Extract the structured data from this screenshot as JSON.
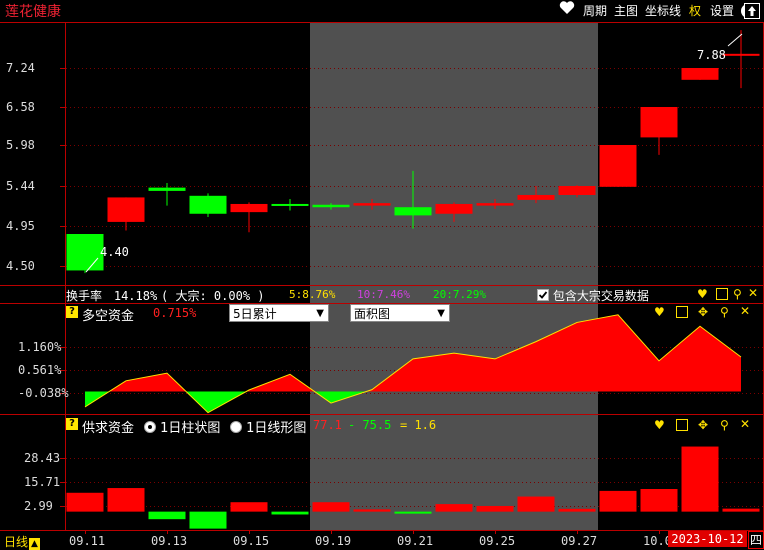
{
  "topbar": {
    "stock_name": "莲花健康",
    "menu": [
      "周期",
      "主图",
      "坐标线",
      "权",
      "设置"
    ],
    "heart_icon": "heart-icon",
    "restore_icon": "restore-icon",
    "up_icon": "up-arrow-icon"
  },
  "main": {
    "yticks": [
      "7.24",
      "6.58",
      "5.98",
      "5.44",
      "4.95",
      "4.50"
    ],
    "low_label": "4.40",
    "high_label": "7.88",
    "candles": [
      {
        "o": 4.86,
        "c": 4.45,
        "h": 4.86,
        "l": 4.42
      },
      {
        "o": 5.0,
        "c": 5.3,
        "h": 5.3,
        "l": 4.9
      },
      {
        "o": 5.42,
        "c": 5.38,
        "h": 5.48,
        "l": 5.2
      },
      {
        "o": 5.32,
        "c": 5.1,
        "h": 5.35,
        "l": 5.06
      },
      {
        "o": 5.12,
        "c": 5.22,
        "h": 5.24,
        "l": 4.88
      },
      {
        "o": 5.22,
        "c": 5.2,
        "h": 5.28,
        "l": 5.14
      },
      {
        "o": 5.21,
        "c": 5.18,
        "h": 5.23,
        "l": 5.15
      },
      {
        "o": 5.2,
        "c": 5.23,
        "h": 5.28,
        "l": 5.15
      },
      {
        "o": 5.18,
        "c": 5.08,
        "h": 5.64,
        "l": 4.92
      },
      {
        "o": 5.1,
        "c": 5.22,
        "h": 5.24,
        "l": 5.0
      },
      {
        "o": 5.2,
        "c": 5.23,
        "h": 5.28,
        "l": 5.16
      },
      {
        "o": 5.27,
        "c": 5.33,
        "h": 5.44,
        "l": 5.23
      },
      {
        "o": 5.33,
        "c": 5.44,
        "h": 5.45,
        "l": 5.3
      },
      {
        "o": 5.43,
        "c": 5.98,
        "h": 5.98,
        "l": 5.43
      },
      {
        "o": 6.1,
        "c": 6.58,
        "h": 6.58,
        "l": 5.85
      },
      {
        "o": 7.04,
        "c": 7.24,
        "h": 7.24,
        "l": 7.04
      },
      {
        "o": 7.48,
        "c": 7.48,
        "h": 7.88,
        "l": 6.9
      }
    ],
    "colors": {
      "up": "#ff0000",
      "down": "#00ff00",
      "flat": "#ff0000"
    }
  },
  "turnover": {
    "label": "换手率",
    "value": "14.18%",
    "block": "( 大宗: 0.00% )",
    "ma5": "5:8.76%",
    "ma10": "10:7.46%",
    "ma20": "20:7.29%",
    "checkbox_label": "包含大宗交易数据"
  },
  "panel2": {
    "title": "多空资金",
    "value": "0.715%",
    "dropdown1": "5日累计",
    "dropdown2": "面积图",
    "yticks": [
      "1.160%",
      "0.561%",
      "-0.038%"
    ],
    "series": [
      -0.4,
      0.28,
      0.48,
      -0.55,
      0.04,
      0.45,
      -0.3,
      0.05,
      0.85,
      1.0,
      0.85,
      1.3,
      1.8,
      2.0,
      0.8,
      1.7,
      0.9
    ]
  },
  "panel3": {
    "title": "供求资金",
    "radio1": "1日柱状图",
    "radio2": "1日线形图",
    "val_a": "77.1",
    "val_b": "- 75.5",
    "val_c": "= 1.6",
    "yticks": [
      "28.43",
      "15.71",
      "2.99"
    ],
    "bars": [
      10.0,
      12.5,
      -4.0,
      -9.0,
      5.0,
      -1.5,
      5.0,
      1.2,
      -0.4,
      4.0,
      3.0,
      8.0,
      1.5,
      11.0,
      12.0,
      34.5,
      1.6
    ]
  },
  "xaxis": {
    "period_label": "日线",
    "labels": [
      "09.11",
      "09.13",
      "09.15",
      "09.19",
      "09.21",
      "09.25",
      "09.27",
      "10.0"
    ],
    "date_box": "2023-10-12",
    "weekday": "四"
  }
}
